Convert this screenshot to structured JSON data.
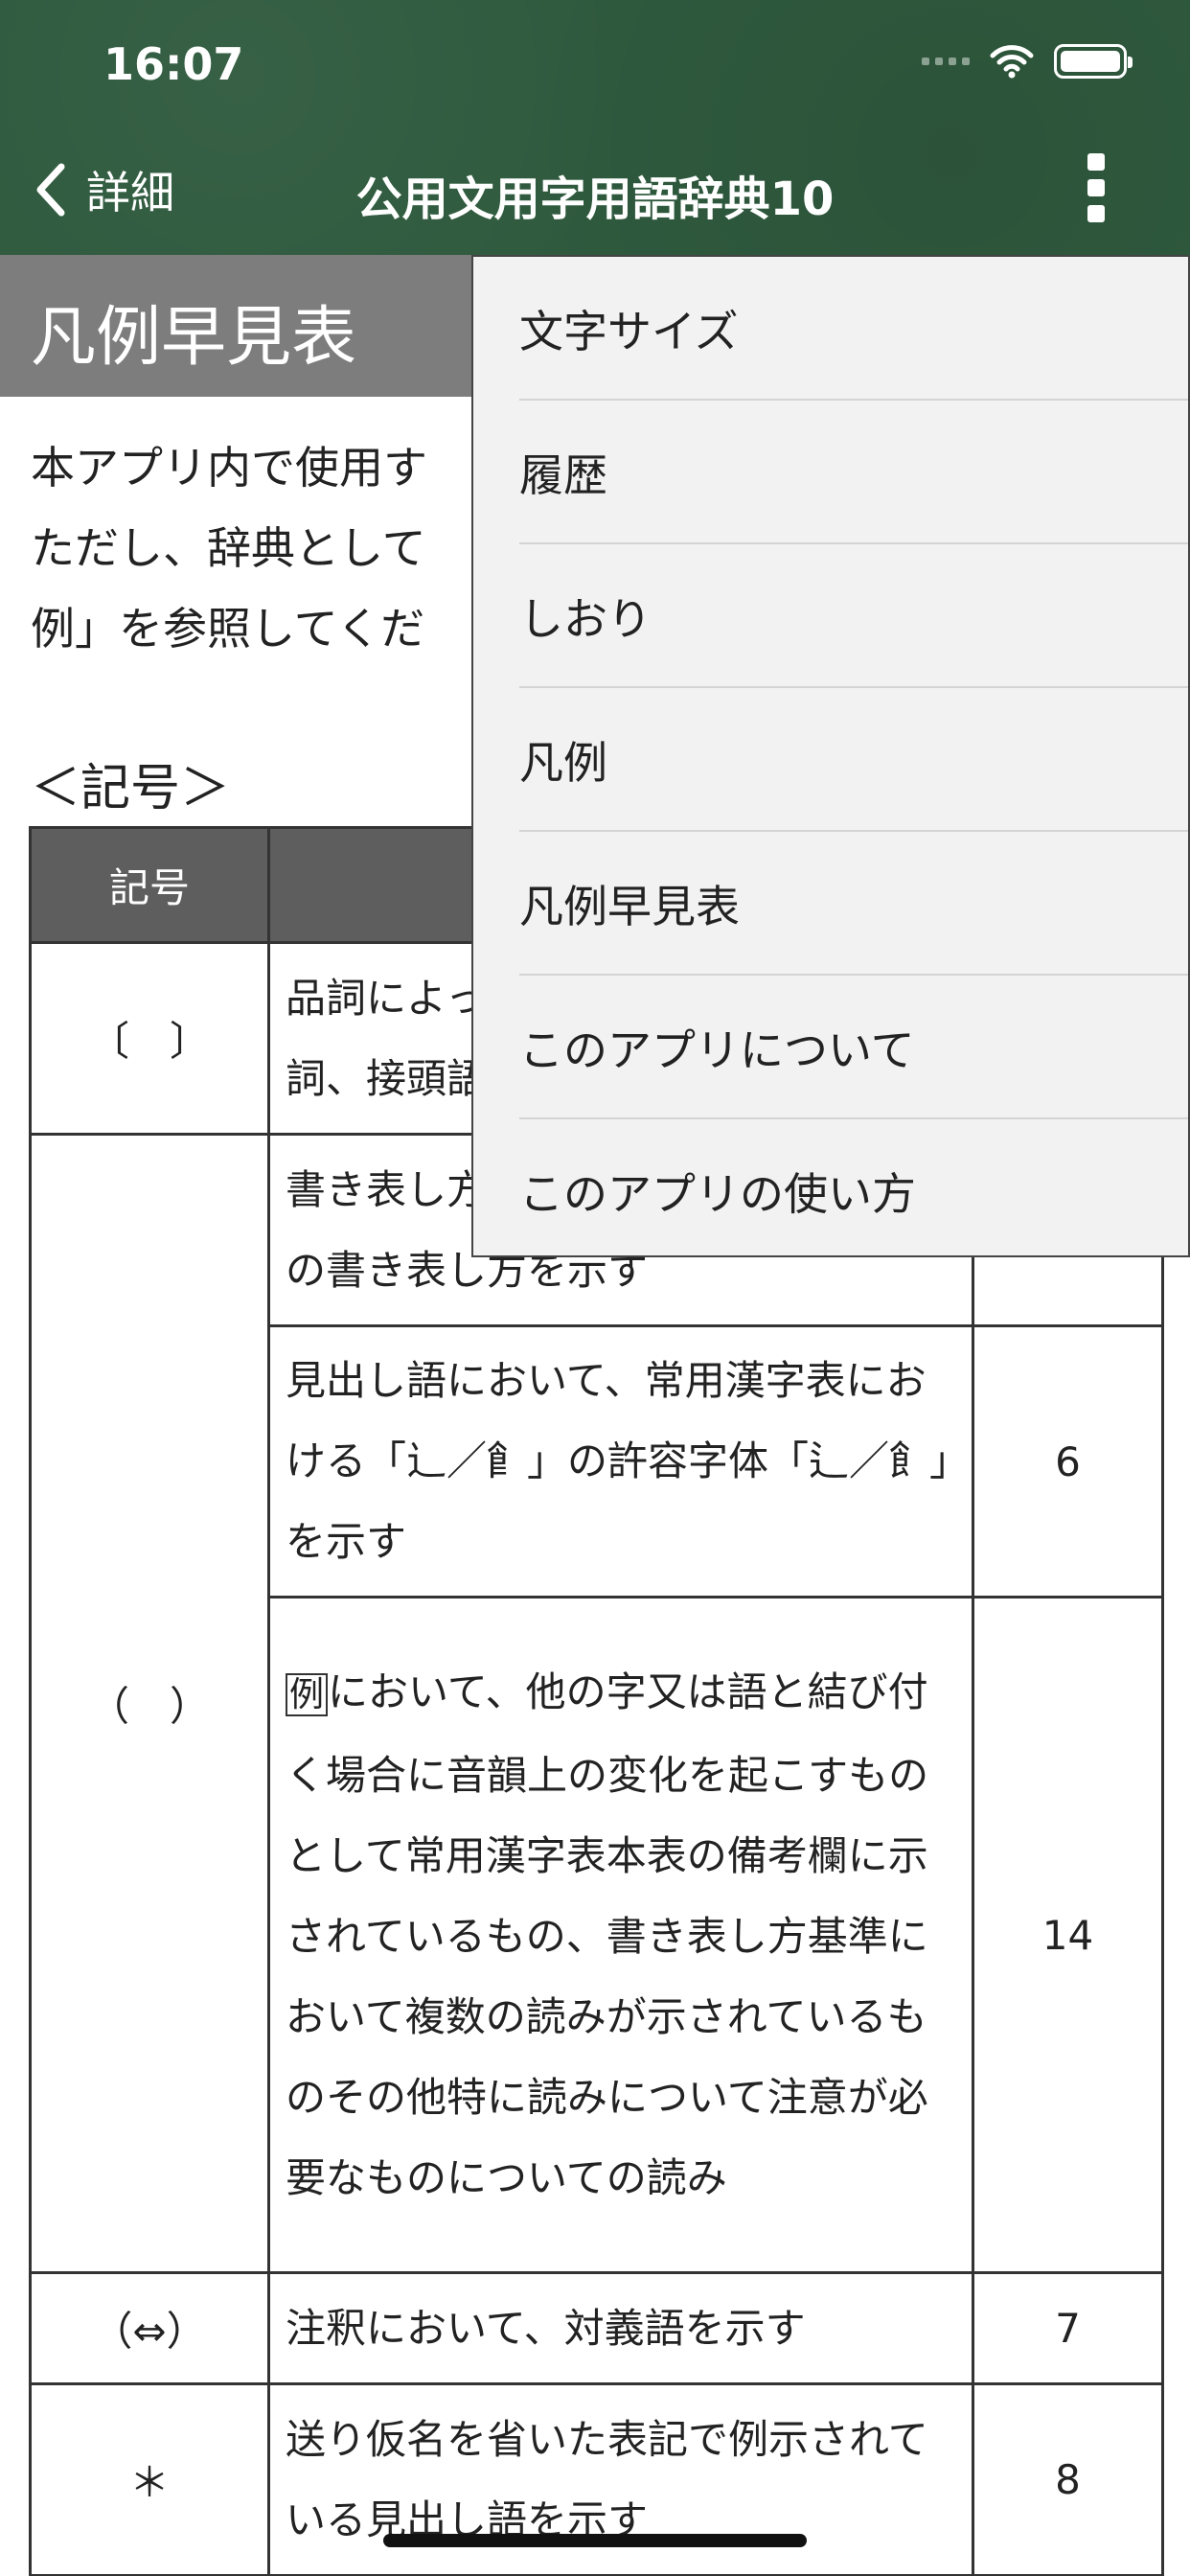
{
  "status_bar": {
    "time": "16:07"
  },
  "nav": {
    "back_label": "詳細",
    "title": "公用文用字用語辞典10"
  },
  "section": {
    "title": "凡例早見表",
    "intro_lines": [
      "本アプリ内で使用す",
      "ただし、辞典として",
      "例」を参照してくだ"
    ]
  },
  "symbols_heading": "＜記号＞",
  "table": {
    "headers": [
      "記号",
      "",
      ""
    ],
    "rows": [
      {
        "symbol": "〔　〕",
        "description": "品詞によっ\n詞、接頭語",
        "page": ""
      },
      {
        "symbol": "（　）",
        "description": "書き表し方\nの書き表し方を示す",
        "page": ""
      },
      {
        "symbol": "",
        "description": "見出し語において、常用漢字表における「⻌／𩙿」の許容字体「⻍／飠」を示す",
        "page": "6"
      },
      {
        "symbol": "",
        "description_marker": "例",
        "description": "において、他の字又は語と結び付く場合に音韻上の変化を起こすものとして常用漢字表本表の備考欄に示されているもの、書き表し方基準において複数の読みが示されているものその他特に読みについて注意が必要なものについての読み",
        "page": "14"
      },
      {
        "symbol": "（⇔）",
        "description": "注釈において、対義語を示す",
        "page": "7"
      },
      {
        "symbol": "＊",
        "description": "送り仮名を省いた表記で例示されている見出し語を示す",
        "page": "8"
      }
    ]
  },
  "menu": {
    "items": [
      "文字サイズ",
      "履歴",
      "しおり",
      "凡例",
      "凡例早見表",
      "このアプリについて",
      "このアプリの使い方"
    ]
  }
}
